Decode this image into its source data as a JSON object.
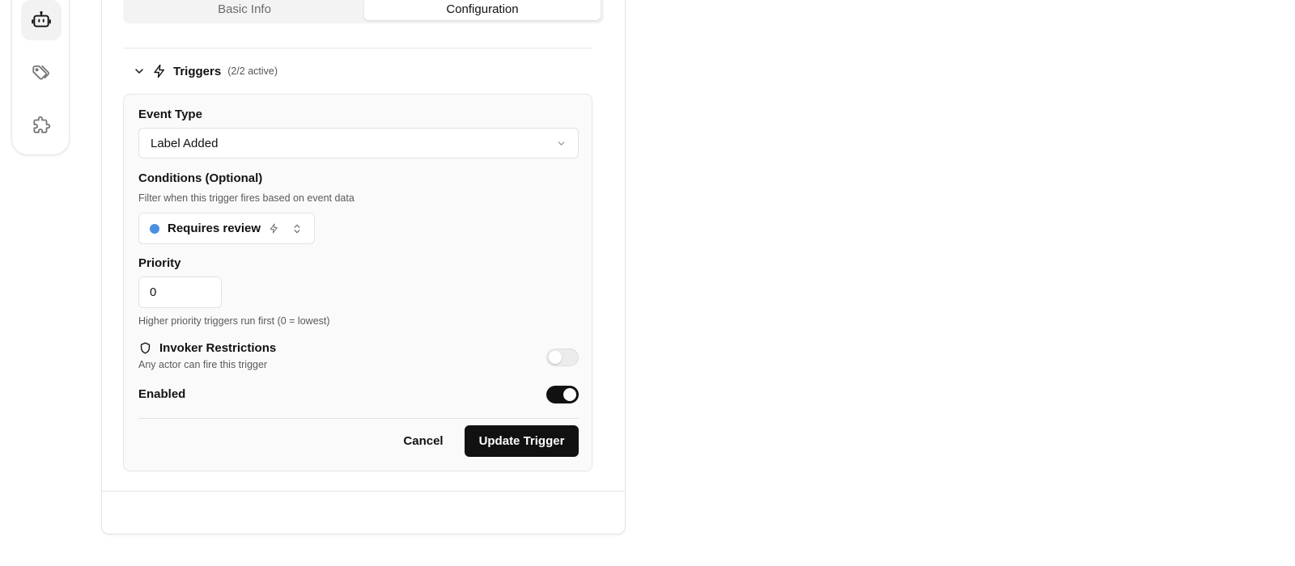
{
  "tabs": [
    {
      "label": "Basic Info",
      "active": false
    },
    {
      "label": "Configuration",
      "active": true
    }
  ],
  "rail": {
    "items": [
      {
        "icon": "bot-icon",
        "active": true
      },
      {
        "icon": "tags-icon",
        "active": false
      },
      {
        "icon": "puzzle-icon",
        "active": false
      }
    ]
  },
  "triggers": {
    "title": "Triggers",
    "count": "(2/2 active)",
    "expanded": true
  },
  "form": {
    "event_type_label": "Event Type",
    "event_type_value": "Label Added",
    "conditions_label": "Conditions (Optional)",
    "conditions_hint": "Filter when this trigger fires based on event data",
    "condition": {
      "label": "Requires review",
      "color": "#4a90e2"
    },
    "priority_label": "Priority",
    "priority_value": "0",
    "priority_hint": "Higher priority triggers run first (0 = lowest)",
    "invoker_label": "Invoker Restrictions",
    "invoker_hint": "Any actor can fire this trigger",
    "invoker_enabled": false,
    "enabled_label": "Enabled",
    "enabled": true
  },
  "actions": {
    "cancel_label": "Cancel",
    "submit_label": "Update Trigger"
  }
}
